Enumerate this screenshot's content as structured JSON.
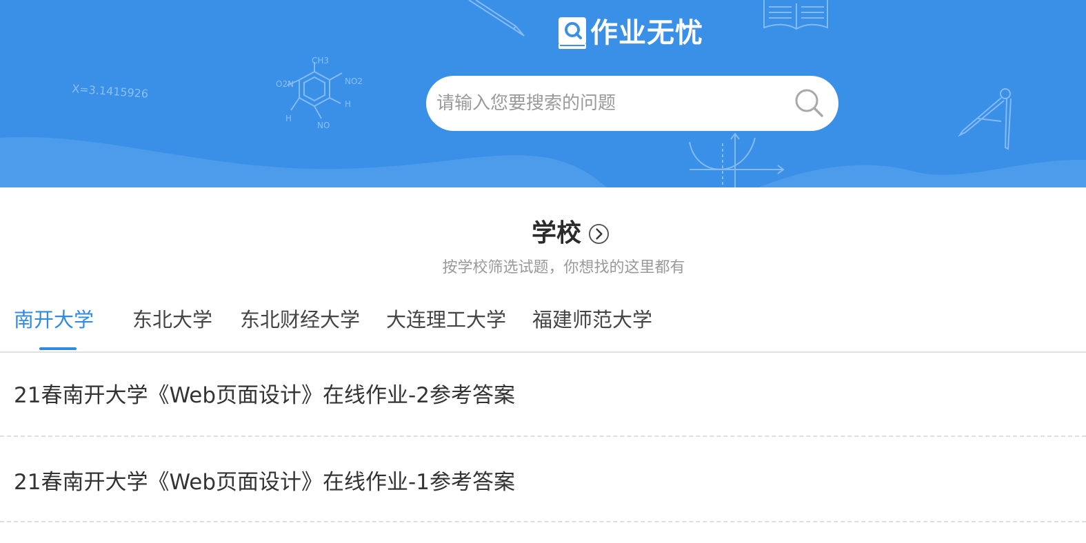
{
  "header": {
    "logo_text": "作业无忧",
    "background_color": "#3a8fe6",
    "decorations": {
      "pi_formula": "X=3.1415926",
      "molecule_labels": [
        "CH3",
        "O2N",
        "NO2",
        "H",
        "H",
        "NO"
      ]
    }
  },
  "search": {
    "placeholder": "请输入您要搜索的问题",
    "value": "",
    "icon": "search-icon"
  },
  "section": {
    "title": "学校",
    "subtitle": "按学校筛选试题，你想找的这里都有",
    "title_icon": "chevron-right-circle-icon"
  },
  "tabs": [
    {
      "label": "南开大学",
      "active": true
    },
    {
      "label": "东北大学",
      "active": false
    },
    {
      "label": "东北财经大学",
      "active": false
    },
    {
      "label": "大连理工大学",
      "active": false
    },
    {
      "label": "福建师范大学",
      "active": false
    }
  ],
  "list": [
    {
      "title": "21春南开大学《Web页面设计》在线作业-2参考答案"
    },
    {
      "title": "21春南开大学《Web页面设计》在线作业-1参考答案"
    }
  ],
  "colors": {
    "accent": "#2f8ae6",
    "header": "#3a8fe6"
  }
}
